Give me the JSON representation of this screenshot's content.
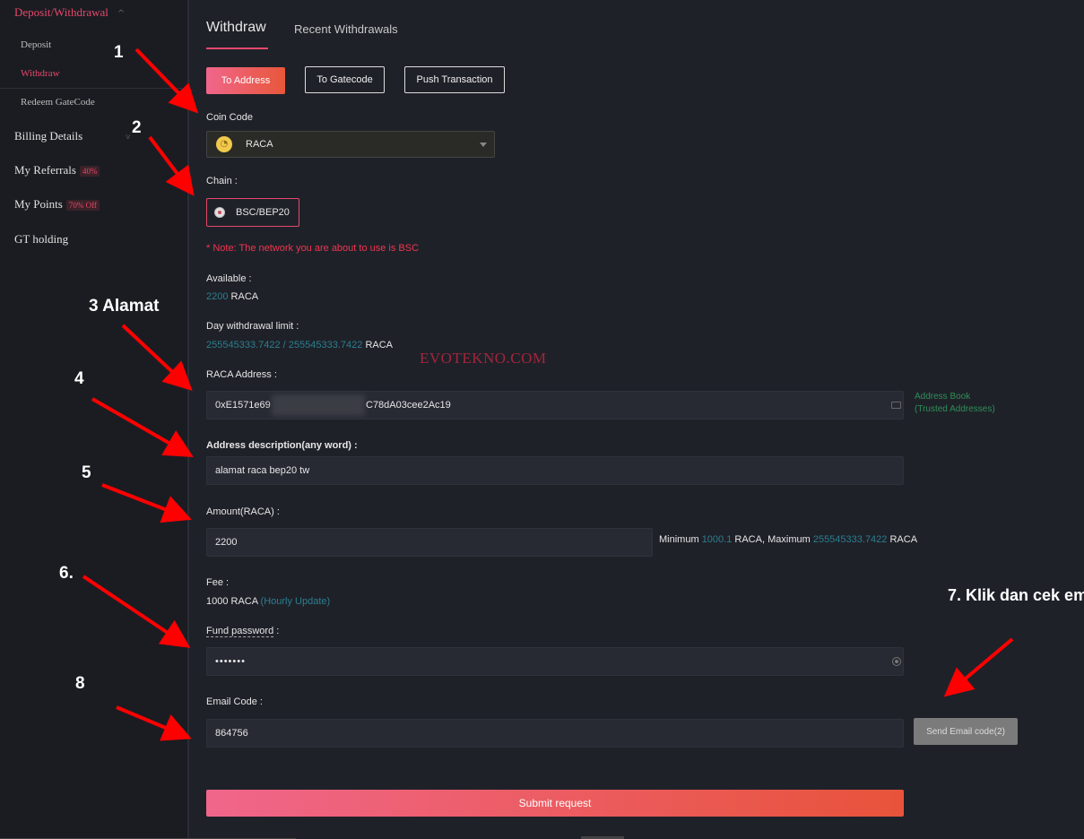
{
  "sidebar": {
    "header": "Deposit/Withdrawal",
    "sub_items": [
      "Deposit",
      "Withdraw",
      "Redeem GateCode"
    ],
    "items": [
      {
        "label": "Billing Details"
      },
      {
        "label": "My Referrals",
        "badge": "40%"
      },
      {
        "label": "My Points",
        "badge": "70% Off"
      },
      {
        "label": "GT holding"
      }
    ]
  },
  "tabs": {
    "active": "Withdraw",
    "other": "Recent Withdrawals"
  },
  "mode_buttons": [
    "To Address",
    "To Gatecode",
    "Push Transaction"
  ],
  "coin": {
    "label": "Coin Code",
    "value": "RACA"
  },
  "chain": {
    "label": "Chain",
    "value": "BSC/BEP20",
    "note": "* Note: The network you are about to use is BSC"
  },
  "available": {
    "label": "Available",
    "amount": "2200",
    "unit": "RACA"
  },
  "limit": {
    "label": "Day withdrawal limit",
    "used": "255545333.7422",
    "sep": "/",
    "total": "255545333.7422",
    "unit": "RACA"
  },
  "address": {
    "label": "RACA Address",
    "prefix": "0xE1571e69",
    "suffix": "C78dA03cee2Ac19",
    "book_line1": "Address Book",
    "book_line2": "(Trusted Addresses)"
  },
  "description": {
    "label": "Address description(any word)",
    "value": "alamat raca bep20 tw"
  },
  "amount": {
    "label": "Amount(RACA)",
    "value": "2200",
    "min_label": "Minimum",
    "min_value": "1000.1",
    "min_unit": "RACA,",
    "max_label": "Maximum",
    "max_value": "255545333.7422",
    "max_unit": "RACA"
  },
  "fee": {
    "label": "Fee",
    "value": "1000 RACA",
    "update": "(Hourly Update)"
  },
  "fund_password": {
    "label": "Fund password",
    "value": "•••••••"
  },
  "email_code": {
    "label": "Email Code",
    "value": "864756",
    "send_button": "Send Email code(2)"
  },
  "submit_label": "Submit request",
  "watermark": "EVOTEKNO.COM",
  "annotations": [
    "1",
    "2",
    "3 Alamat",
    "4",
    "5",
    "6.",
    "7. Klik dan cek em",
    "8"
  ],
  "colors": {
    "accent": "#e5486a",
    "teal": "#2a7f8e",
    "green": "#2f8f57",
    "arrow": "#ff0000"
  }
}
